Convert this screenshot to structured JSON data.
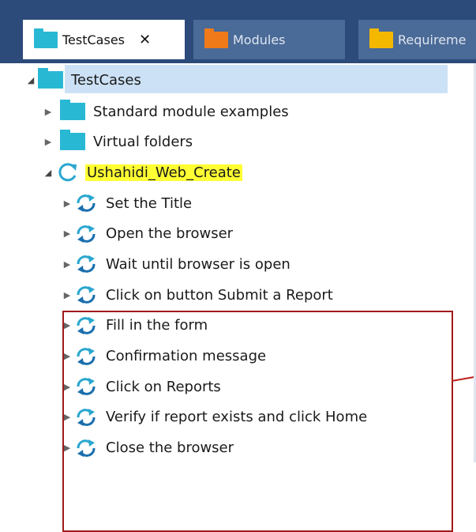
{
  "tabs": {
    "active": {
      "label": "TestCases",
      "close": "✕",
      "folder_color": "#29b8d4"
    },
    "modules": {
      "label": "Modules",
      "folder_color": "#f07a1a"
    },
    "requirements": {
      "label": "Requireme",
      "folder_color": "#f5b800"
    }
  },
  "tree": {
    "root": "TestCases",
    "folders": [
      "Standard module examples",
      "Virtual folders"
    ],
    "testcase": "Ushahidi_Web_Create",
    "steps_above": [
      "Set the Title",
      "Open the browser"
    ],
    "steps_boxed": [
      "Wait until browser is open",
      "Click on button Submit a Report",
      "Fill in the form",
      "Confirmation message",
      "Click on Reports",
      "Verify if report exists and click Home",
      "Close the browser"
    ]
  },
  "colors": {
    "header_bg": "#2c4a7a",
    "highlight": "#ffff33",
    "selection": "#cce1f5",
    "annotation": "#a11a1a",
    "icon": "#2aa7cf"
  }
}
